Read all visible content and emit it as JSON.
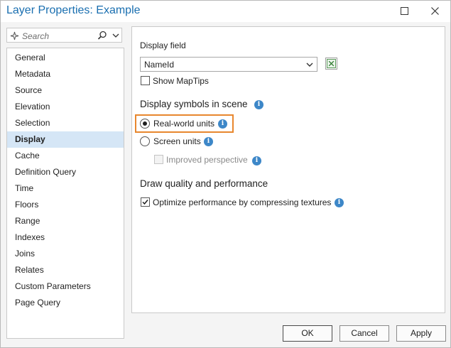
{
  "window": {
    "title": "Layer Properties: Example"
  },
  "search": {
    "placeholder": "Search"
  },
  "sidebar": {
    "items": [
      {
        "label": "General"
      },
      {
        "label": "Metadata"
      },
      {
        "label": "Source"
      },
      {
        "label": "Elevation"
      },
      {
        "label": "Selection"
      },
      {
        "label": "Display",
        "selected": true
      },
      {
        "label": "Cache"
      },
      {
        "label": "Definition Query"
      },
      {
        "label": "Time"
      },
      {
        "label": "Floors"
      },
      {
        "label": "Range"
      },
      {
        "label": "Indexes"
      },
      {
        "label": "Joins"
      },
      {
        "label": "Relates"
      },
      {
        "label": "Custom Parameters"
      },
      {
        "label": "Page Query"
      }
    ]
  },
  "display": {
    "display_field_label": "Display field",
    "display_field_value": "NameId",
    "show_maptips_label": "Show MapTips",
    "show_maptips_checked": false,
    "symbols_heading": "Display symbols in scene",
    "real_world_label": "Real-world units",
    "real_world_selected": true,
    "screen_units_label": "Screen units",
    "screen_units_selected": false,
    "improved_perspective_label": "Improved perspective",
    "improved_perspective_enabled": false,
    "quality_heading": "Draw quality and performance",
    "optimize_label": "Optimize performance by compressing textures",
    "optimize_checked": true,
    "highlight_color": "#e8872e",
    "info_icon_color": "#3d87c8"
  },
  "footer": {
    "ok": "OK",
    "cancel": "Cancel",
    "apply": "Apply"
  },
  "colors": {
    "title": "#1a6fb0",
    "selected_bg": "#d5e6f6"
  }
}
